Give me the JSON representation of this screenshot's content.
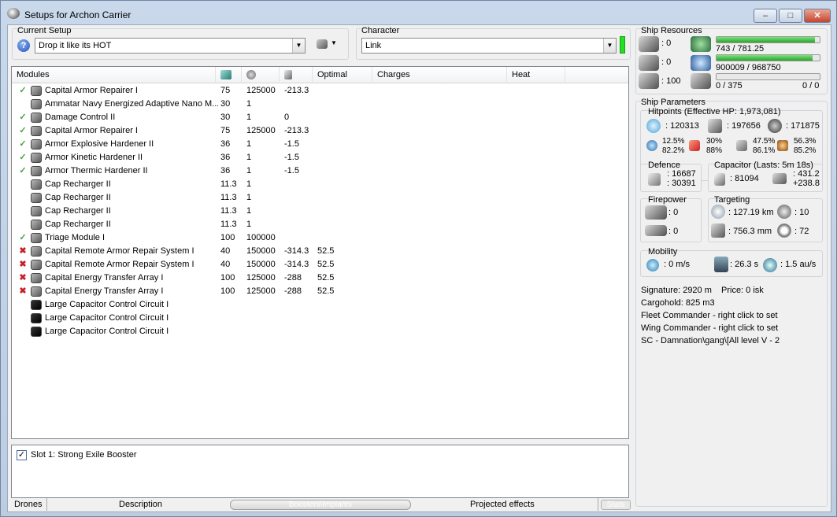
{
  "window": {
    "title": "Setups for Archon Carrier"
  },
  "setup": {
    "label": "Current Setup",
    "value": "Drop it like its HOT"
  },
  "character": {
    "label": "Character",
    "value": "Link"
  },
  "modules": {
    "headers": [
      "Modules",
      "",
      "",
      "",
      "Optimal",
      "Charges",
      "Heat"
    ],
    "rows": [
      {
        "status": "ok",
        "name": "Capital Armor Repairer I",
        "cpu": "75",
        "pg": "125000",
        "cap": "-213.3",
        "optimal": ""
      },
      {
        "status": "",
        "name": "Ammatar Navy Energized Adaptive Nano M...",
        "cpu": "30",
        "pg": "1",
        "cap": "",
        "optimal": ""
      },
      {
        "status": "ok",
        "name": "Damage Control II",
        "cpu": "30",
        "pg": "1",
        "cap": "0",
        "optimal": ""
      },
      {
        "status": "ok",
        "name": "Capital Armor Repairer I",
        "cpu": "75",
        "pg": "125000",
        "cap": "-213.3",
        "optimal": ""
      },
      {
        "status": "ok",
        "name": "Armor Explosive Hardener II",
        "cpu": "36",
        "pg": "1",
        "cap": "-1.5",
        "optimal": ""
      },
      {
        "status": "ok",
        "name": "Armor Kinetic Hardener II",
        "cpu": "36",
        "pg": "1",
        "cap": "-1.5",
        "optimal": ""
      },
      {
        "status": "ok",
        "name": "Armor Thermic Hardener II",
        "cpu": "36",
        "pg": "1",
        "cap": "-1.5",
        "optimal": ""
      },
      {
        "status": "",
        "name": "Cap Recharger II",
        "cpu": "11.3",
        "pg": "1",
        "cap": "",
        "optimal": ""
      },
      {
        "status": "",
        "name": "Cap Recharger II",
        "cpu": "11.3",
        "pg": "1",
        "cap": "",
        "optimal": ""
      },
      {
        "status": "",
        "name": "Cap Recharger II",
        "cpu": "11.3",
        "pg": "1",
        "cap": "",
        "optimal": ""
      },
      {
        "status": "",
        "name": "Cap Recharger II",
        "cpu": "11.3",
        "pg": "1",
        "cap": "",
        "optimal": ""
      },
      {
        "status": "ok",
        "name": "Triage Module I",
        "cpu": "100",
        "pg": "100000",
        "cap": "",
        "optimal": ""
      },
      {
        "status": "err",
        "name": "Capital Remote Armor Repair System I",
        "cpu": "40",
        "pg": "150000",
        "cap": "-314.3",
        "optimal": "52.5"
      },
      {
        "status": "err",
        "name": "Capital Remote Armor Repair System I",
        "cpu": "40",
        "pg": "150000",
        "cap": "-314.3",
        "optimal": "52.5"
      },
      {
        "status": "err",
        "name": "Capital Energy Transfer Array I",
        "cpu": "100",
        "pg": "125000",
        "cap": "-288",
        "optimal": "52.5"
      },
      {
        "status": "err",
        "name": "Capital Energy Transfer Array I",
        "cpu": "100",
        "pg": "125000",
        "cap": "-288",
        "optimal": "52.5"
      },
      {
        "status": "",
        "name": "Large Capacitor Control Circuit I",
        "cpu": "",
        "pg": "",
        "cap": "",
        "optimal": ""
      },
      {
        "status": "",
        "name": "Large Capacitor Control Circuit I",
        "cpu": "",
        "pg": "",
        "cap": "",
        "optimal": ""
      },
      {
        "status": "",
        "name": "Large Capacitor Control Circuit I",
        "cpu": "",
        "pg": "",
        "cap": "",
        "optimal": ""
      }
    ]
  },
  "boosters": {
    "item": "Slot 1: Strong Exile Booster"
  },
  "bottom_tabs": {
    "drones": "Drones",
    "description": "Description",
    "boosters": "Boosters\\Implants",
    "projected": "Projected effects",
    "stats": "Stats"
  },
  "resources": {
    "label": "Ship Resources",
    "turrets": ": 0",
    "launchers": ": 0",
    "calibration": ": 100",
    "cpu": "743 / 781.25",
    "cpu_fraction": 0.951,
    "powergrid": "900009 / 968750",
    "pg_fraction": 0.929,
    "drone_bay": "0 / 375",
    "drone_bw": "0 / 0"
  },
  "params": {
    "label": "Ship Parameters",
    "hp_label": "Hitpoints (Effective HP: 1,973,081)",
    "shield_hp": ": 120313",
    "armor_hp": ": 197656",
    "hull_hp": ": 171875",
    "res": [
      [
        "12.5%",
        "82.2%"
      ],
      [
        "30%",
        "88%"
      ],
      [
        "47.5%",
        "86.1%"
      ],
      [
        "56.3%",
        "85.2%"
      ]
    ],
    "defence_label": "Defence",
    "def1": ": 16687",
    "def2": ": 30391",
    "cap_label": "Capacitor (Lasts: 5m 18s)",
    "cap_amount": ": 81094",
    "cap_rate1": ": 431.2",
    "cap_rate2": "+238.8",
    "fire_label": "Firepower",
    "fire1": ": 0",
    "fire2": ": 0",
    "target_label": "Targeting",
    "range": ": 127.19 km",
    "targets": ": 10",
    "sigres": ": 756.3 mm",
    "scan": ": 72",
    "mob_label": "Mobility",
    "speed": ": 0 m/s",
    "align": ": 26.3 s",
    "warp": ": 1.5 au/s"
  },
  "info": {
    "signature": "Signature: 2920 m",
    "price": "Price: 0 isk",
    "cargohold": "Cargohold: 825 m3",
    "fleet": "Fleet Commander - right click to set",
    "wing": "Wing Commander - right click to set",
    "sc": "SC - Damnation\\gang\\[All level V - 2"
  }
}
